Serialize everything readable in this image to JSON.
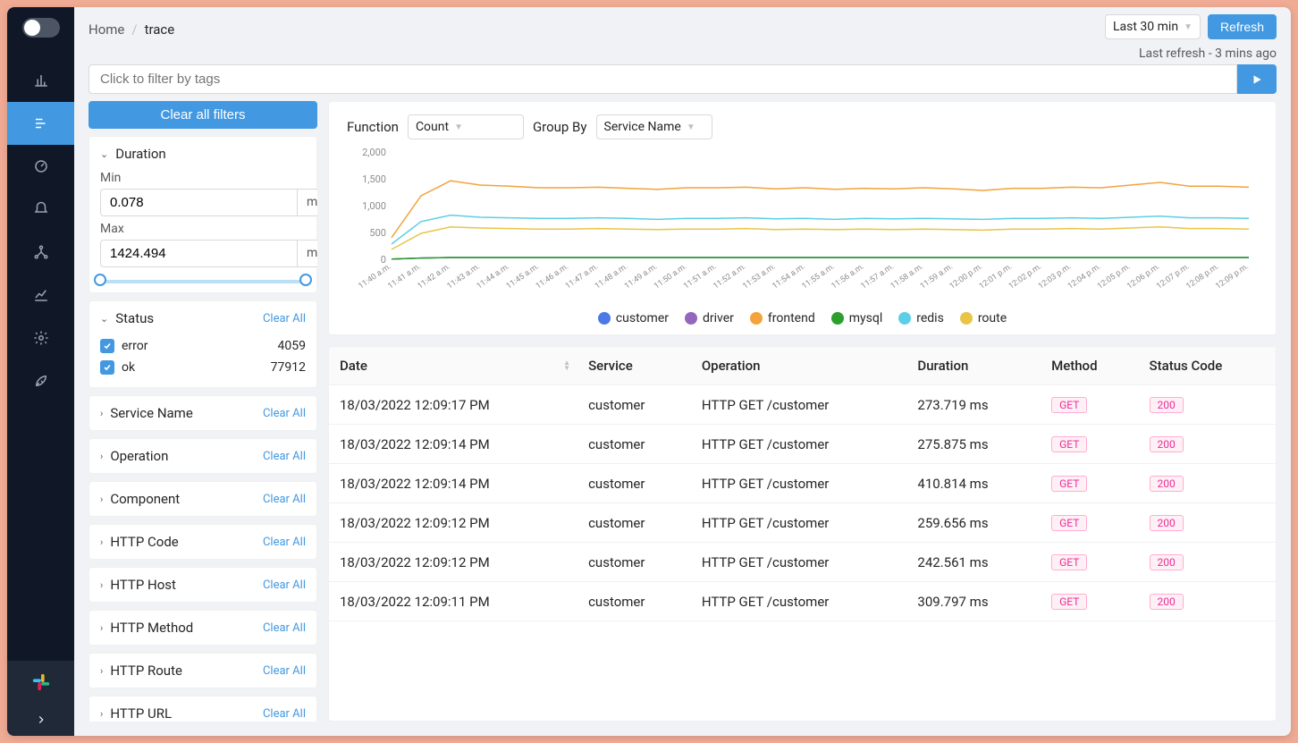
{
  "breadcrumb": {
    "home": "Home",
    "current": "trace"
  },
  "time_range": "Last 30 min",
  "refresh_btn": "Refresh",
  "last_refresh": "Last refresh - 3 mins ago",
  "filter_placeholder": "Click to filter by tags",
  "clear_all_filters": "Clear all filters",
  "filters": {
    "duration": {
      "title": "Duration",
      "min_label": "Min",
      "min_value": "0.078",
      "min_unit": "ms",
      "max_label": "Max",
      "max_value": "1424.494",
      "max_unit": "ms"
    },
    "status": {
      "title": "Status",
      "clear": "Clear All",
      "items": [
        {
          "label": "error",
          "count": "4059"
        },
        {
          "label": "ok",
          "count": "77912"
        }
      ]
    },
    "collapsed": [
      {
        "title": "Service Name",
        "clear": "Clear All"
      },
      {
        "title": "Operation",
        "clear": "Clear All"
      },
      {
        "title": "Component",
        "clear": "Clear All"
      },
      {
        "title": "HTTP Code",
        "clear": "Clear All"
      },
      {
        "title": "HTTP Host",
        "clear": "Clear All"
      },
      {
        "title": "HTTP Method",
        "clear": "Clear All"
      },
      {
        "title": "HTTP Route",
        "clear": "Clear All"
      },
      {
        "title": "HTTP URL",
        "clear": "Clear All"
      }
    ]
  },
  "chart": {
    "function_label": "Function",
    "function_value": "Count",
    "groupby_label": "Group By",
    "groupby_value": "Service Name"
  },
  "chart_data": {
    "type": "line",
    "ylabel": "",
    "ylim": [
      0,
      2000
    ],
    "yticks": [
      "0",
      "500",
      "1,000",
      "1,500",
      "2,000"
    ],
    "x": [
      "11:40 a.m.",
      "11:41 a.m.",
      "11:42 a.m.",
      "11:43 a.m.",
      "11:44 a.m.",
      "11:45 a.m.",
      "11:46 a.m.",
      "11:47 a.m.",
      "11:48 a.m.",
      "11:49 a.m.",
      "11:50 a.m.",
      "11:51 a.m.",
      "11:52 a.m.",
      "11:53 a.m.",
      "11:54 a.m.",
      "11:55 a.m.",
      "11:56 a.m.",
      "11:57 a.m.",
      "11:58 a.m.",
      "11:59 a.m.",
      "12:00 p.m.",
      "12:01 p.m.",
      "12:02 p.m.",
      "12:03 p.m.",
      "12:04 p.m.",
      "12:05 p.m.",
      "12:06 p.m.",
      "12:07 p.m.",
      "12:08 p.m.",
      "12:09 p.m."
    ],
    "series": [
      {
        "name": "customer",
        "color": "#4c78e8",
        "values": [
          20,
          40,
          50,
          50,
          50,
          50,
          50,
          50,
          50,
          50,
          50,
          50,
          50,
          50,
          50,
          50,
          50,
          50,
          50,
          50,
          50,
          50,
          50,
          50,
          50,
          50,
          50,
          50,
          50,
          50
        ]
      },
      {
        "name": "driver",
        "color": "#9467bd",
        "values": [
          20,
          40,
          50,
          50,
          50,
          50,
          50,
          50,
          50,
          50,
          50,
          50,
          50,
          50,
          50,
          50,
          50,
          50,
          50,
          50,
          50,
          50,
          50,
          50,
          50,
          50,
          50,
          50,
          50,
          50
        ]
      },
      {
        "name": "frontend",
        "color": "#f2a33c",
        "values": [
          420,
          1200,
          1480,
          1400,
          1380,
          1350,
          1350,
          1360,
          1340,
          1320,
          1350,
          1350,
          1360,
          1330,
          1350,
          1320,
          1340,
          1330,
          1350,
          1330,
          1300,
          1340,
          1340,
          1360,
          1350,
          1400,
          1450,
          1380,
          1380,
          1360
        ]
      },
      {
        "name": "mysql",
        "color": "#2ca02c",
        "values": [
          20,
          40,
          50,
          50,
          50,
          50,
          50,
          50,
          50,
          50,
          50,
          50,
          50,
          50,
          50,
          50,
          50,
          50,
          50,
          50,
          50,
          50,
          50,
          50,
          50,
          50,
          50,
          50,
          50,
          50
        ]
      },
      {
        "name": "redis",
        "color": "#5ccfe6",
        "values": [
          300,
          720,
          840,
          800,
          790,
          780,
          780,
          790,
          780,
          760,
          780,
          780,
          790,
          770,
          780,
          760,
          780,
          770,
          780,
          770,
          760,
          780,
          780,
          790,
          780,
          800,
          820,
          790,
          790,
          780
        ]
      },
      {
        "name": "route",
        "color": "#e8c547",
        "values": [
          200,
          500,
          620,
          600,
          590,
          580,
          580,
          590,
          580,
          570,
          580,
          580,
          590,
          570,
          580,
          570,
          580,
          570,
          580,
          570,
          560,
          580,
          580,
          590,
          580,
          600,
          620,
          590,
          590,
          580
        ]
      }
    ]
  },
  "table": {
    "headers": {
      "date": "Date",
      "service": "Service",
      "operation": "Operation",
      "duration": "Duration",
      "method": "Method",
      "status": "Status Code"
    },
    "rows": [
      {
        "date": "18/03/2022 12:09:17 PM",
        "service": "customer",
        "operation": "HTTP GET /customer",
        "duration": "273.719 ms",
        "method": "GET",
        "status": "200"
      },
      {
        "date": "18/03/2022 12:09:14 PM",
        "service": "customer",
        "operation": "HTTP GET /customer",
        "duration": "275.875 ms",
        "method": "GET",
        "status": "200"
      },
      {
        "date": "18/03/2022 12:09:14 PM",
        "service": "customer",
        "operation": "HTTP GET /customer",
        "duration": "410.814 ms",
        "method": "GET",
        "status": "200"
      },
      {
        "date": "18/03/2022 12:09:12 PM",
        "service": "customer",
        "operation": "HTTP GET /customer",
        "duration": "259.656 ms",
        "method": "GET",
        "status": "200"
      },
      {
        "date": "18/03/2022 12:09:12 PM",
        "service": "customer",
        "operation": "HTTP GET /customer",
        "duration": "242.561 ms",
        "method": "GET",
        "status": "200"
      },
      {
        "date": "18/03/2022 12:09:11 PM",
        "service": "customer",
        "operation": "HTTP GET /customer",
        "duration": "309.797 ms",
        "method": "GET",
        "status": "200"
      }
    ]
  }
}
